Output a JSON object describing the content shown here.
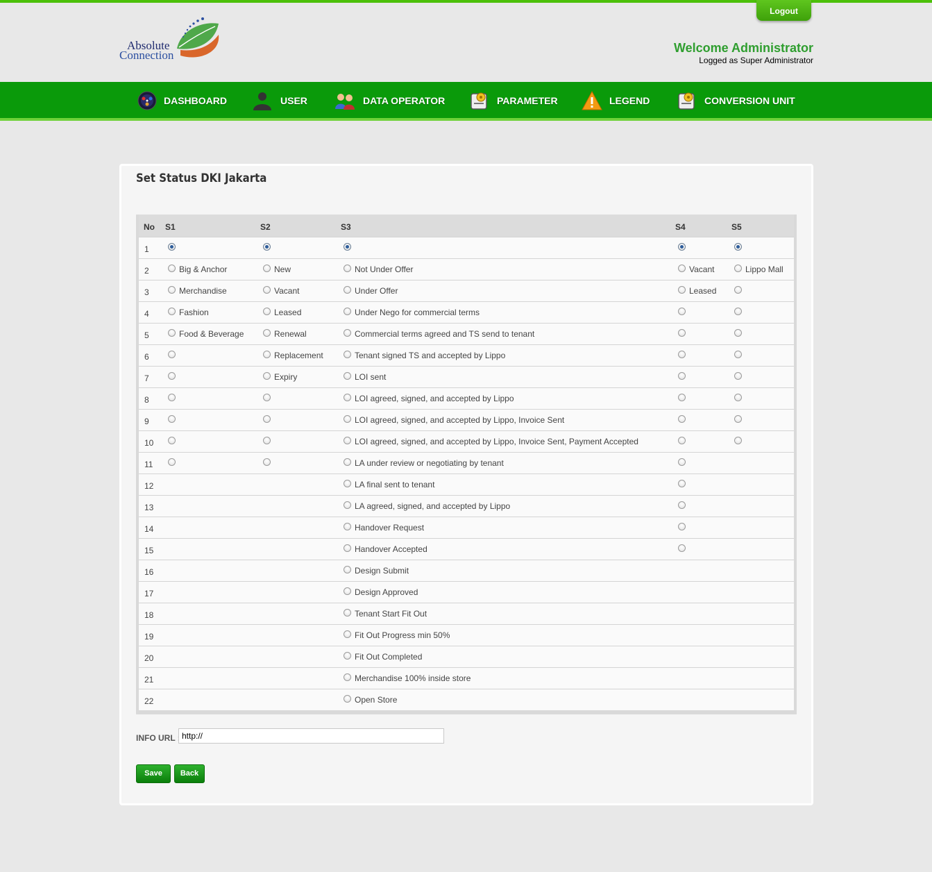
{
  "header": {
    "logo_line1": "Absolute",
    "logo_line2": "Connection",
    "logout_label": "Logout",
    "welcome": "Welcome Administrator",
    "logged_as": "Logged as Super Administrator"
  },
  "nav": [
    {
      "label": "DASHBOARD",
      "icon": "dashboard-icon"
    },
    {
      "label": "USER",
      "icon": "user-icon"
    },
    {
      "label": "DATA OPERATOR",
      "icon": "data-operator-icon"
    },
    {
      "label": "PARAMETER",
      "icon": "parameter-icon"
    },
    {
      "label": "LEGEND",
      "icon": "warning-icon"
    },
    {
      "label": "CONVERSION UNIT",
      "icon": "conversion-icon"
    }
  ],
  "panel": {
    "title": "Set Status DKI Jakarta"
  },
  "table": {
    "headers": [
      "No",
      "S1",
      "S2",
      "S3",
      "S4",
      "S5"
    ],
    "rows": [
      {
        "no": "1",
        "s1": "",
        "s2": "",
        "s3": "",
        "s4": "",
        "s5": ""
      },
      {
        "no": "2",
        "s1": "Big & Anchor",
        "s2": "New",
        "s3": "Not Under Offer",
        "s4": "Vacant",
        "s5": "Lippo Mall"
      },
      {
        "no": "3",
        "s1": "Merchandise",
        "s2": "Vacant",
        "s3": "Under Offer",
        "s4": "Leased",
        "s5": ""
      },
      {
        "no": "4",
        "s1": "Fashion",
        "s2": "Leased",
        "s3": "Under Nego for commercial terms",
        "s4": "",
        "s5": ""
      },
      {
        "no": "5",
        "s1": "Food & Beverage",
        "s2": "Renewal",
        "s3": "Commercial terms agreed and TS send to tenant",
        "s4": "",
        "s5": ""
      },
      {
        "no": "6",
        "s1": "",
        "s2": "Replacement",
        "s3": "Tenant signed TS and accepted by Lippo",
        "s4": "",
        "s5": ""
      },
      {
        "no": "7",
        "s1": "",
        "s2": "Expiry",
        "s3": "LOI sent",
        "s4": "",
        "s5": ""
      },
      {
        "no": "8",
        "s1": "",
        "s2": "",
        "s3": "LOI agreed, signed, and accepted by Lippo",
        "s4": "",
        "s5": ""
      },
      {
        "no": "9",
        "s1": "",
        "s2": "",
        "s3": "LOI agreed, signed, and accepted by Lippo, Invoice Sent",
        "s4": "",
        "s5": ""
      },
      {
        "no": "10",
        "s1": "",
        "s2": "",
        "s3": "LOI agreed, signed, and accepted by Lippo, Invoice Sent, Payment Accepted",
        "s4": "",
        "s5": ""
      },
      {
        "no": "11",
        "s1": "",
        "s2": "",
        "s3": "LA under review or negotiating by tenant",
        "s4": "",
        "s5": null
      },
      {
        "no": "12",
        "s1": null,
        "s2": null,
        "s3": "LA final sent to tenant",
        "s4": "",
        "s5": null
      },
      {
        "no": "13",
        "s1": null,
        "s2": null,
        "s3": "LA agreed, signed, and accepted by Lippo",
        "s4": "",
        "s5": null
      },
      {
        "no": "14",
        "s1": null,
        "s2": null,
        "s3": "Handover Request",
        "s4": "",
        "s5": null
      },
      {
        "no": "15",
        "s1": null,
        "s2": null,
        "s3": "Handover Accepted",
        "s4": "",
        "s5": null
      },
      {
        "no": "16",
        "s1": null,
        "s2": null,
        "s3": "Design Submit",
        "s4": null,
        "s5": null
      },
      {
        "no": "17",
        "s1": null,
        "s2": null,
        "s3": "Design Approved",
        "s4": null,
        "s5": null
      },
      {
        "no": "18",
        "s1": null,
        "s2": null,
        "s3": "Tenant Start Fit Out",
        "s4": null,
        "s5": null
      },
      {
        "no": "19",
        "s1": null,
        "s2": null,
        "s3": "Fit Out Progress min 50%",
        "s4": null,
        "s5": null
      },
      {
        "no": "20",
        "s1": null,
        "s2": null,
        "s3": "Fit Out Completed",
        "s4": null,
        "s5": null
      },
      {
        "no": "21",
        "s1": null,
        "s2": null,
        "s3": "Merchandise 100% inside store",
        "s4": null,
        "s5": null
      },
      {
        "no": "22",
        "s1": null,
        "s2": null,
        "s3": "Open Store",
        "s4": null,
        "s5": null
      }
    ],
    "selected_row": "1"
  },
  "form": {
    "info_url_label": "INFO URL :",
    "info_url_value": "http://",
    "save_label": "Save",
    "back_label": "Back"
  },
  "colors": {
    "accent_green": "#0a9a0a",
    "top_bar": "#4cc00a",
    "welcome_text": "#2f9e2f"
  }
}
